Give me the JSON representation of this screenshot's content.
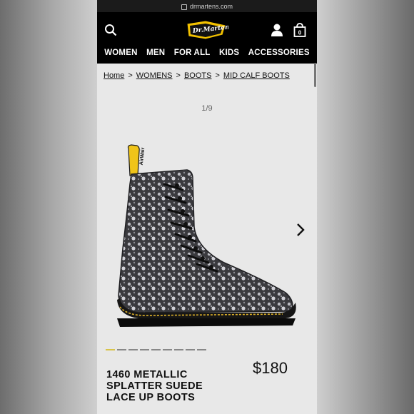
{
  "browser": {
    "url": "drmartens.com"
  },
  "header": {
    "logo_text": "Dr. Martens",
    "nav": [
      "WOMEN",
      "MEN",
      "FOR ALL",
      "KIDS",
      "ACCESSORIES"
    ]
  },
  "breadcrumb": [
    "Home",
    "WOMENS",
    "BOOTS",
    "MID CALF BOOTS"
  ],
  "gallery": {
    "counter": "1/9",
    "total": 9,
    "active_index": 1
  },
  "product": {
    "title_lines": [
      "1460 METALLIC",
      "SPLATTER SUEDE",
      "LACE UP BOOTS"
    ],
    "price": "$180"
  },
  "colors": {
    "header_bg": "#000000",
    "accent_yellow": "#f2c100",
    "page_bg": "#e8e8e8"
  }
}
